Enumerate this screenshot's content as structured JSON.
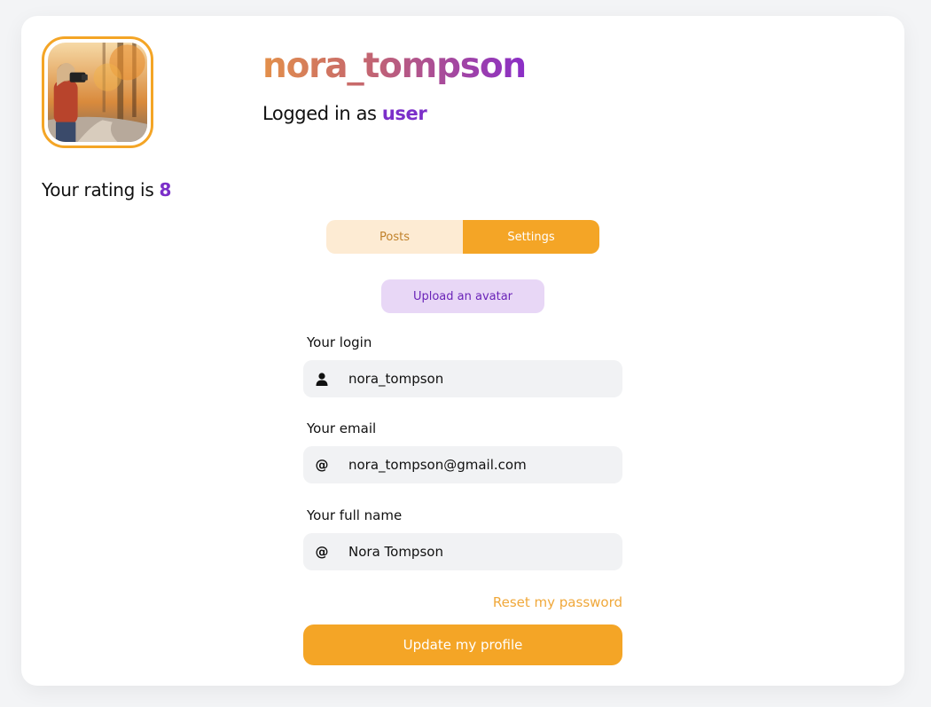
{
  "profile": {
    "username": "nora_tompson",
    "logged_in_prefix": "Logged in as",
    "role": "user",
    "rating_prefix": "Your rating is",
    "rating_value": "8"
  },
  "tabs": [
    {
      "label": "Posts",
      "active": false
    },
    {
      "label": "Settings",
      "active": true
    }
  ],
  "upload_avatar_label": "Upload an avatar",
  "form": {
    "login": {
      "label": "Your login",
      "value": "nora_tompson",
      "icon": "user-icon"
    },
    "email": {
      "label": "Your email",
      "value": "nora_tompson@gmail.com",
      "icon": "at-icon"
    },
    "full_name": {
      "label": "Your full name",
      "value": "Nora Tompson",
      "icon": "at-icon"
    }
  },
  "reset_password_label": "Reset my password",
  "update_button_label": "Update my profile",
  "colors": {
    "accent_orange": "#f4a526",
    "accent_purple": "#7b2fc9",
    "upload_bg": "#e8d7f6",
    "tab_inactive_bg": "#fdebd3",
    "field_bg": "#f1f2f4"
  }
}
